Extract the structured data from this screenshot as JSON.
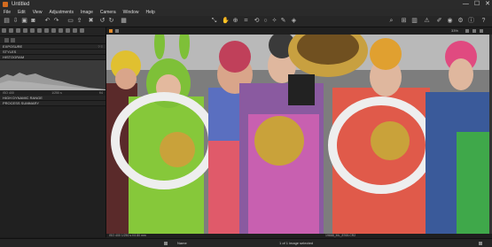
{
  "app": {
    "title": "Untitled"
  },
  "window_controls": {
    "minimize": "—",
    "maximize": "☐",
    "close": "✕"
  },
  "menu": [
    "File",
    "Edit",
    "View",
    "Adjustments",
    "Image",
    "Camera",
    "Window",
    "Help"
  ],
  "left_panel": {
    "sections": {
      "exposure": "EXPOSURE",
      "styles": "STYLES",
      "histogram": "HISTOGRAM",
      "high_dynamic_range": "HIGH DYNAMIC RANGE",
      "process_summary": "PROCESS SUMMARY"
    },
    "histogram_info": {
      "left": "ISO 400",
      "center": "1/250 s",
      "right": "f/4"
    }
  },
  "viewer": {
    "zoom": "33%"
  },
  "status": {
    "exif": "ISO 400  1/250 s  f/4  80 mm",
    "filename": "19668_ML_8765.CR2"
  },
  "browser_bar": {
    "sort_label": "Name",
    "selection_text": "1 of 1 image selected"
  },
  "colors": {
    "accent": "#e08a2c",
    "background": "#1b1b1b"
  }
}
